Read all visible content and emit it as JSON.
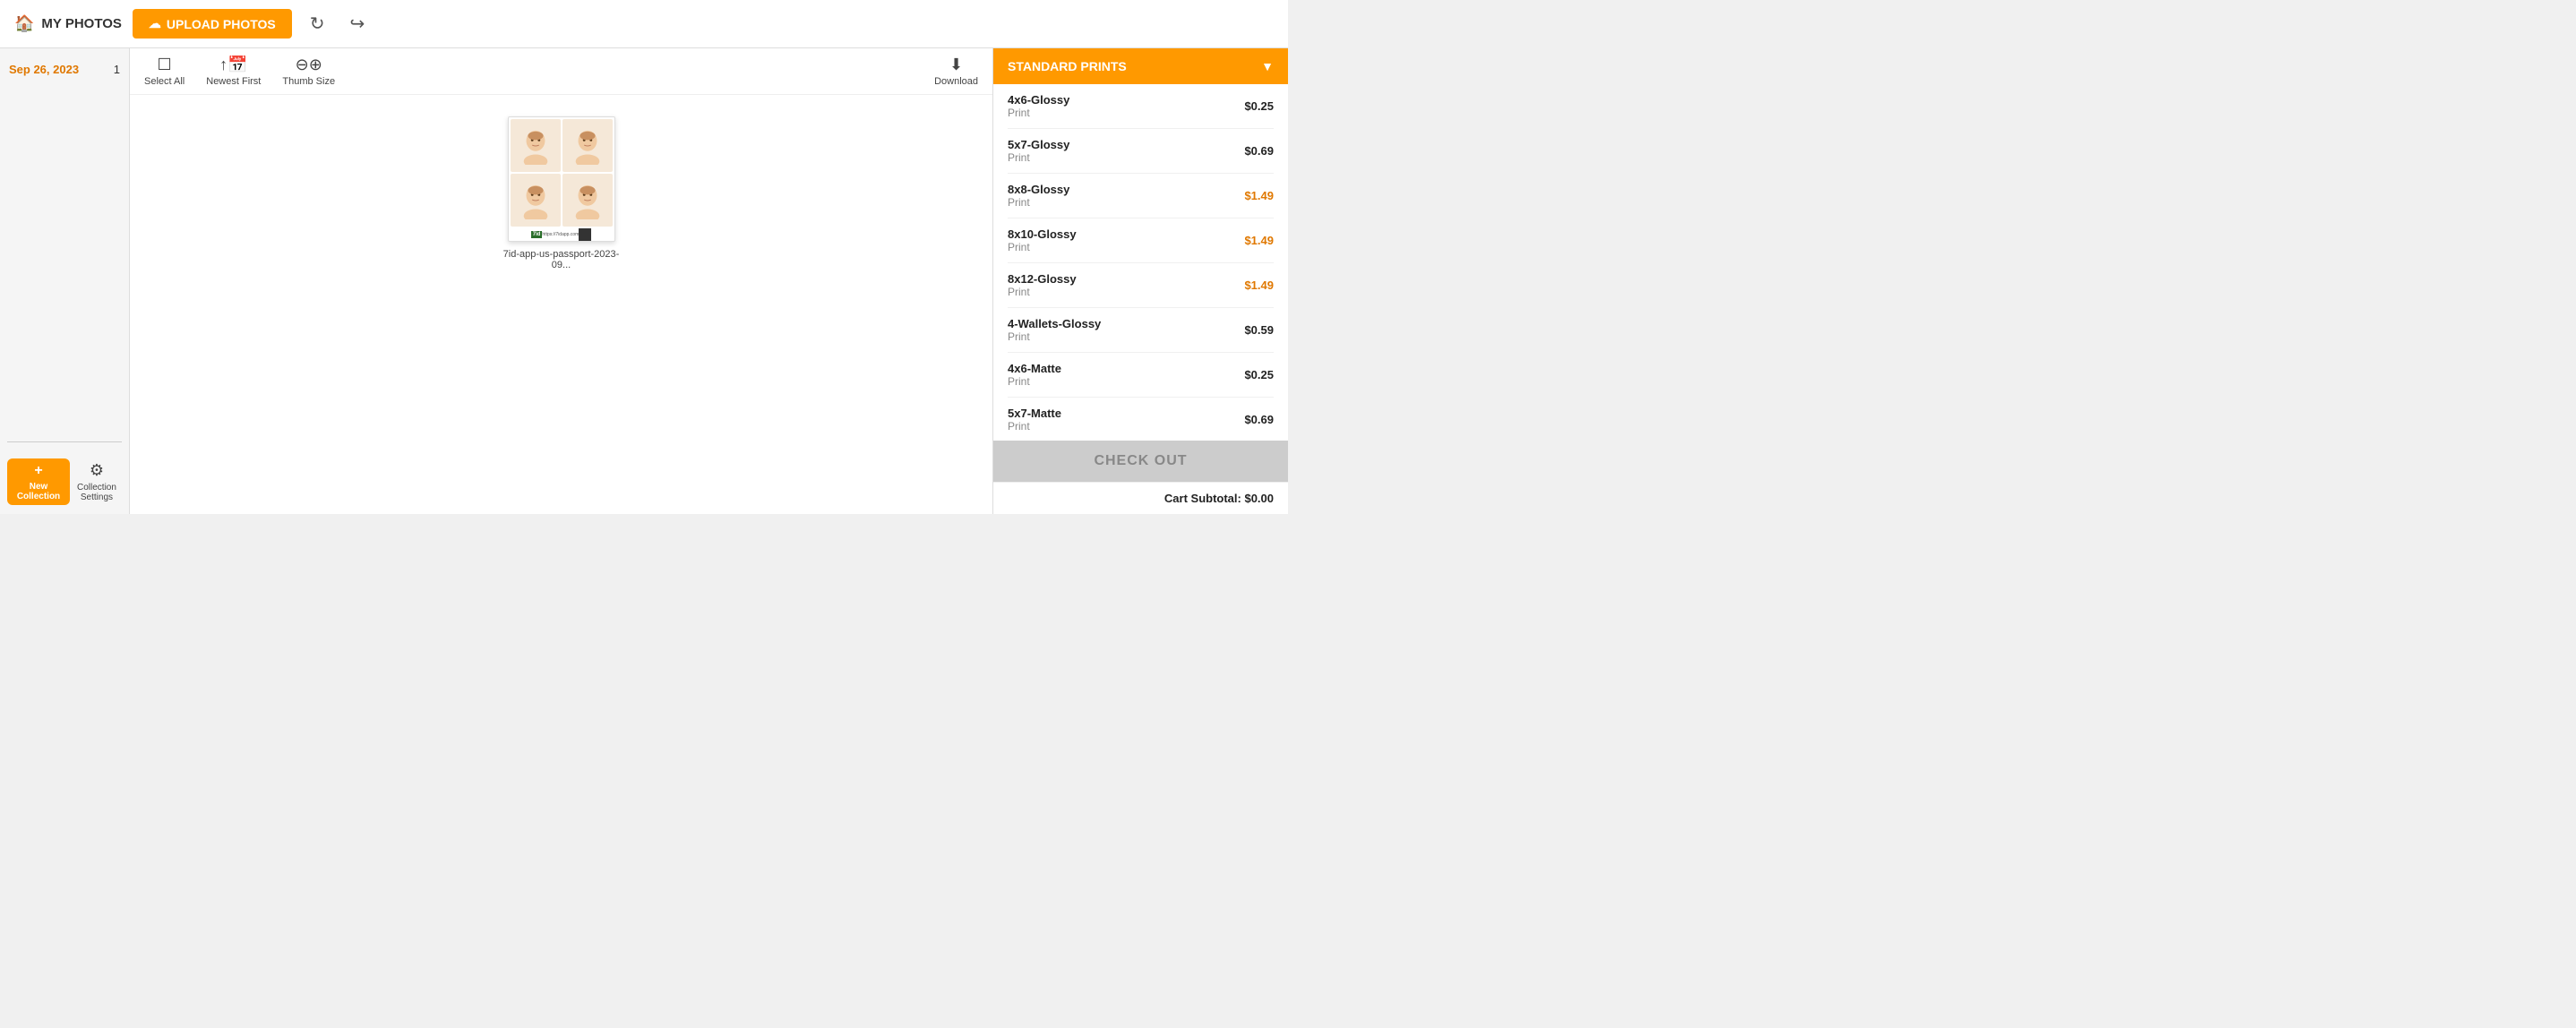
{
  "topbar": {
    "my_photos_label": "MY PHOTOS",
    "upload_label": "UPLOAD PHOTOS",
    "refresh_icon": "↻",
    "share_icon": "↪"
  },
  "sidebar": {
    "date_label": "Sep 26, 2023",
    "date_count": "1",
    "new_collection_label": "New\nCollection",
    "collection_settings_label": "Collection\nSettings"
  },
  "toolbar": {
    "select_all_label": "Select All",
    "newest_first_label": "Newest First",
    "thumb_size_label": "Thumb Size",
    "download_label": "Download"
  },
  "photo": {
    "filename": "7id-app-us-passport-2023-09..."
  },
  "right_panel": {
    "print_type_label": "STANDARD PRINTS",
    "items": [
      {
        "name": "4x6-Glossy",
        "sub": "Print",
        "price": "$0.25",
        "highlight": false
      },
      {
        "name": "5x7-Glossy",
        "sub": "Print",
        "price": "$0.69",
        "highlight": false
      },
      {
        "name": "8x8-Glossy",
        "sub": "Print",
        "price": "$1.49",
        "highlight": true
      },
      {
        "name": "8x10-Glossy",
        "sub": "Print",
        "price": "$1.49",
        "highlight": true
      },
      {
        "name": "8x12-Glossy",
        "sub": "Print",
        "price": "$1.49",
        "highlight": true
      },
      {
        "name": "4-Wallets-Glossy",
        "sub": "Print",
        "price": "$0.59",
        "highlight": false
      },
      {
        "name": "4x6-Matte",
        "sub": "Print",
        "price": "$0.25",
        "highlight": false
      },
      {
        "name": "5x7-Matte",
        "sub": "Print",
        "price": "$0.69",
        "highlight": false
      }
    ],
    "checkout_label": "CHECK OUT",
    "cart_subtotal_label": "Cart Subtotal: $0.00"
  }
}
